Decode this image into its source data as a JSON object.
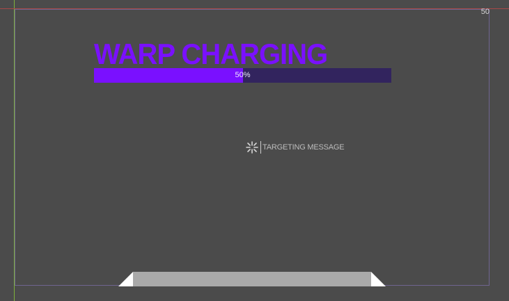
{
  "corner": {
    "value": "50"
  },
  "warp": {
    "title": "WARP CHARGING",
    "progress_text": "50%",
    "progress_fraction": 0.5,
    "accent_color": "#7a10ff",
    "track_color": "#32245e"
  },
  "targeting": {
    "icon": "crosshair-icon",
    "message": "TARGETING MESSAGE"
  },
  "bottom_panel": {
    "fill_color": "#a9a9a9",
    "wing_color": "#ffffff"
  }
}
